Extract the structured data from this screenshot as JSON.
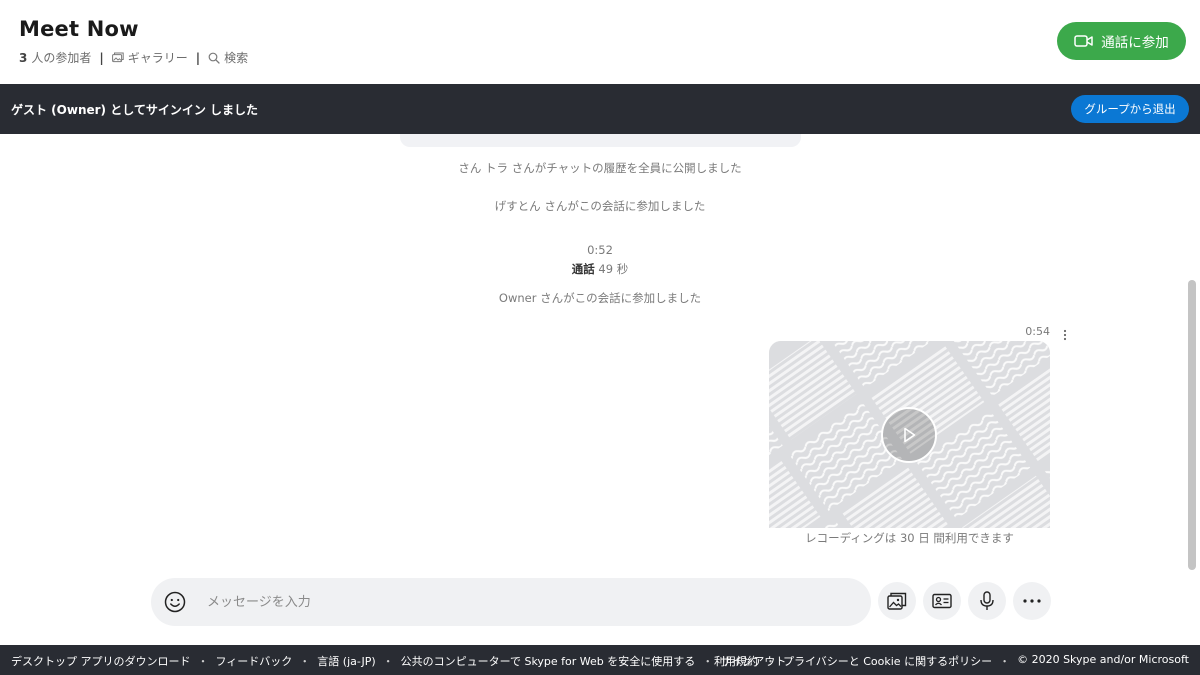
{
  "header": {
    "title": "Meet Now",
    "participant_count": "3",
    "participant_label": "人の参加者",
    "separator": "|",
    "gallery_label": "ギャラリー",
    "search_label": "検索",
    "join_call_label": "通話に参加",
    "join_call_color": "#3ca94b"
  },
  "banner": {
    "text": "ゲスト (Owner) としてサインイン しました",
    "leave_group_label": "グループから退出",
    "background": "#292c33",
    "button_color": "#0b78d4"
  },
  "chat": {
    "system_messages": [
      "さん トラ さんがチャットの履歴を全員に公開しました",
      "げすとん さんがこの会話に参加しました"
    ],
    "call": {
      "time": "0:52",
      "label": "通話",
      "duration": "49 秒"
    },
    "owner_joined": "Owner さんがこの会話に参加しました",
    "video_message": {
      "time": "0:54",
      "note": "レコーディングは 30 日 間利用できます"
    }
  },
  "composer": {
    "placeholder": "メッセージを入力"
  },
  "icons": {
    "gallery": "gallery-icon",
    "search": "search-icon",
    "video_call": "video-call-icon",
    "emoji": "emoji-icon",
    "media": "media-gallery-icon",
    "contact": "contact-card-icon",
    "mic": "microphone-icon",
    "more": "more-icon",
    "play": "play-icon"
  },
  "footer": {
    "separator": "・",
    "left_links": [
      "デスクトップ アプリのダウンロード",
      "フィードバック",
      "言語 (ja-JP)",
      "公共のコンピューターで Skype for Web を安全に使用する",
      "サインアウト"
    ],
    "right_links": [
      "利用規約",
      "プライバシーと Cookie に関するポリシー"
    ],
    "copyright": "© 2020 Skype and/or Microsoft"
  }
}
